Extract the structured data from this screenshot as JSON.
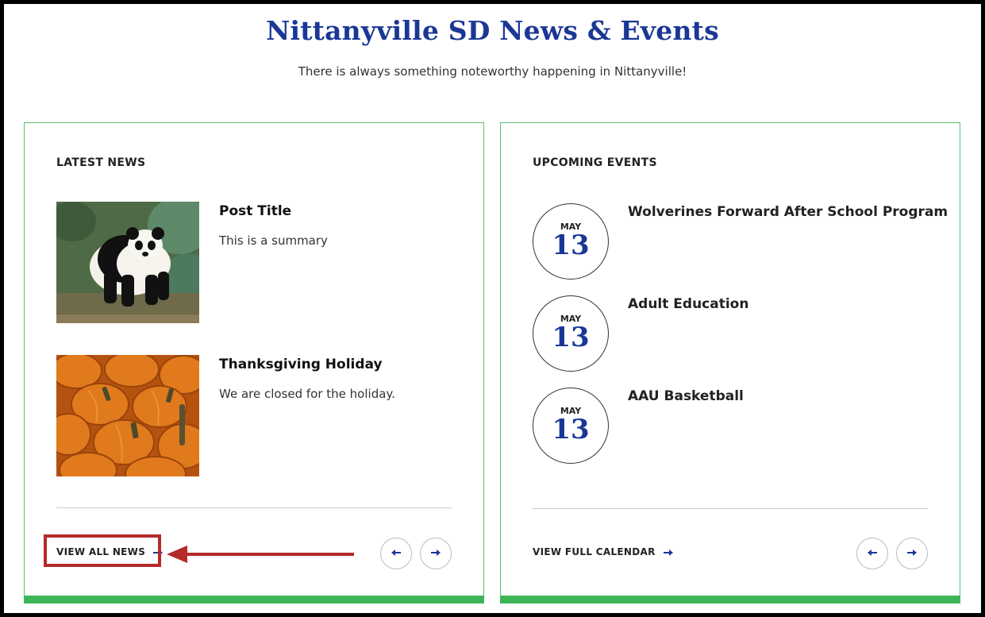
{
  "header": {
    "title": "Nittanyville SD News & Events",
    "subtitle": "There is always something noteworthy happening in Nittanyville!"
  },
  "news": {
    "heading": "LATEST NEWS",
    "items": [
      {
        "title": "Post Title",
        "summary": "This is a summary"
      },
      {
        "title": "Thanksgiving Holiday",
        "summary": "We are closed for the holiday."
      }
    ],
    "view_all_label": "VIEW ALL NEWS"
  },
  "events": {
    "heading": "UPCOMING EVENTS",
    "items": [
      {
        "month": "MAY",
        "day": "13",
        "title": "Wolverines Forward After School Program"
      },
      {
        "month": "MAY",
        "day": "13",
        "title": "Adult Education"
      },
      {
        "month": "MAY",
        "day": "13",
        "title": "AAU Basketball"
      }
    ],
    "view_all_label": "VIEW FULL CALENDAR"
  },
  "icons": {
    "link_arrow": "arrow-right-icon",
    "prev": "arrow-left-icon",
    "next": "arrow-right-icon"
  },
  "colors": {
    "title_blue": "#1b3796",
    "card_border": "#5cbf70",
    "card_bar": "#3db556",
    "annotation_red": "#b52a2a"
  }
}
